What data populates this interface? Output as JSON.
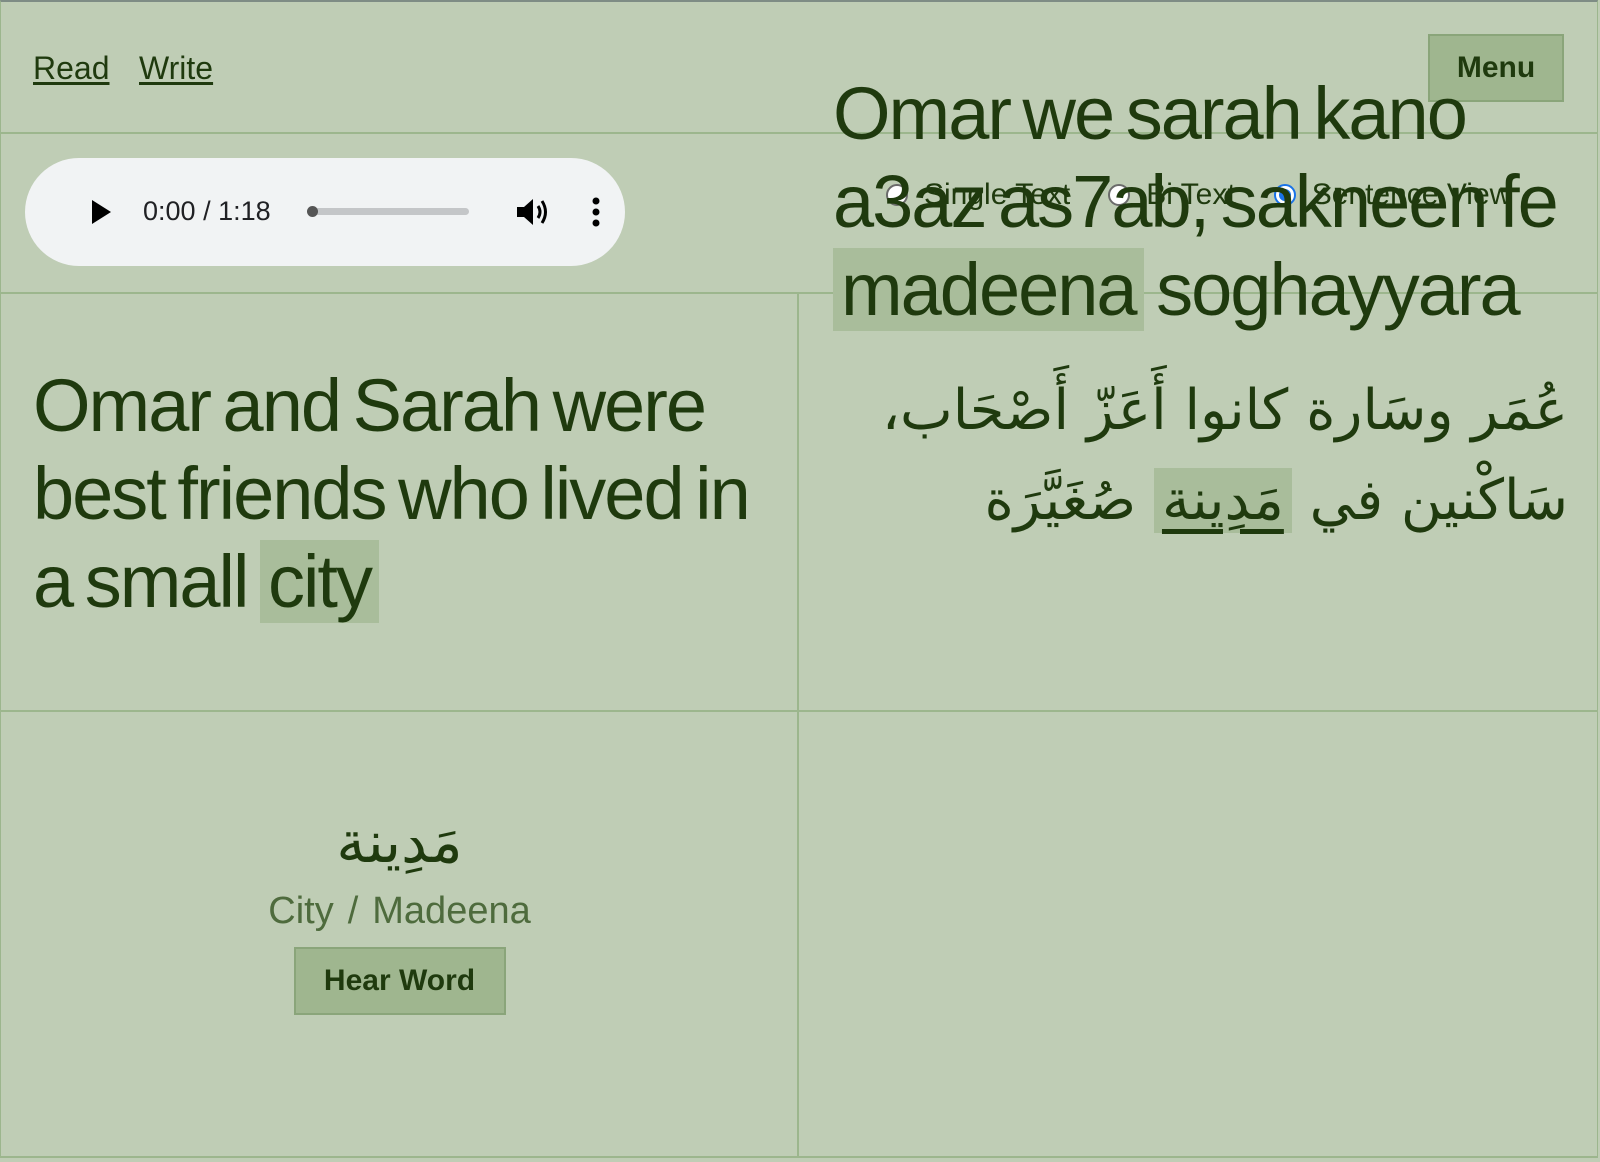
{
  "header": {
    "nav": [
      {
        "label": "Read"
      },
      {
        "label": "Write"
      }
    ],
    "menu_label": "Menu"
  },
  "audio": {
    "current_time": "0:00",
    "separator": " / ",
    "duration": "1:18",
    "progress": 0.0,
    "icons": {
      "play": "play-icon",
      "volume": "volume-icon",
      "more": "more-vertical-icon"
    }
  },
  "view_modes": {
    "options": [
      {
        "label": "Single Text",
        "checked": false
      },
      {
        "label": "Bi Text",
        "checked": false
      },
      {
        "label": "Sentence View",
        "checked": true
      }
    ],
    "accent_color": "#1a73e8"
  },
  "sentence": {
    "english_before": "Omar and Sarah were best friends who lived in a small ",
    "english_highlight": "city",
    "english_after": "",
    "arabic_before": "عُمَر وسَارة كانوا أَعَزّ أَصْحَاب، سَاكْنين في ",
    "arabic_highlight": "مَدِينة",
    "arabic_after": " صُغَيَّرَة",
    "translit_before": "Omar we sarah kano a3az as7ab, sakneen fe ",
    "translit_highlight": "madeena",
    "translit_after": " soghayyara"
  },
  "word": {
    "arabic": "مَدِينة",
    "meaning": "City",
    "separator": "/",
    "transliteration": "Madeena",
    "hear_label": "Hear Word"
  },
  "colors": {
    "background": "#bfcdb5",
    "text": "#1f3a0e",
    "highlight": "#a9bd9b",
    "button": "#9fb68f",
    "divider": "#9cb68d"
  }
}
